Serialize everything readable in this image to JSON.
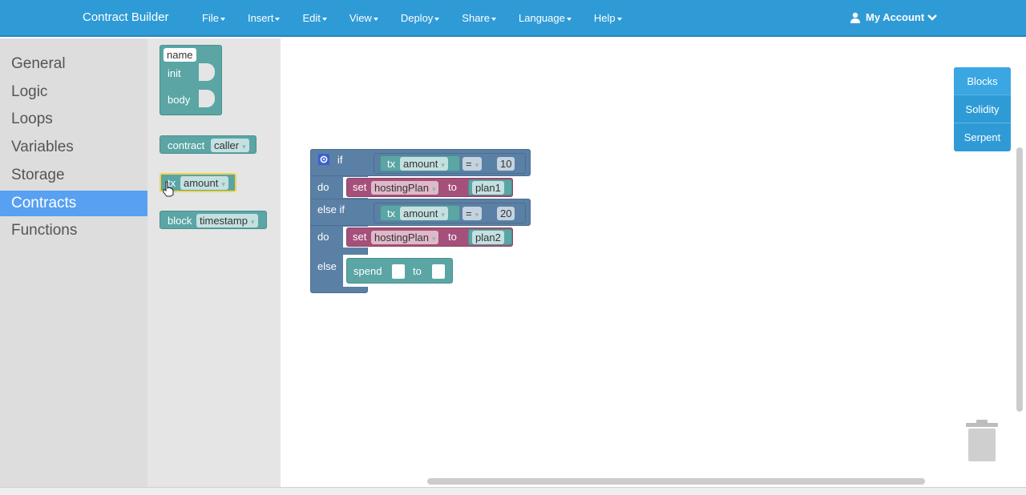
{
  "navbar": {
    "brand": "Contract Builder",
    "menu": [
      "File",
      "Insert",
      "Edit",
      "View",
      "Deploy",
      "Share",
      "Language",
      "Help"
    ],
    "account": "My Account"
  },
  "categories": [
    "General",
    "Logic",
    "Loops",
    "Variables",
    "Storage",
    "Contracts",
    "Functions"
  ],
  "selected_category": "Contracts",
  "flyout": {
    "contract_block": {
      "name_field": "name",
      "init_label": "init",
      "body_label": "body"
    },
    "caller_block": {
      "label": "contract",
      "field": "caller"
    },
    "tx_block": {
      "label": "tx",
      "field": "amount"
    },
    "timestamp_block": {
      "label": "block",
      "field": "timestamp"
    }
  },
  "workspace": {
    "if_label": "if",
    "do_label": "do",
    "elseif_label": "else if",
    "do2_label": "do",
    "else_label": "else",
    "cond1": {
      "tx": "tx",
      "field": "amount",
      "op": "=",
      "value": "10"
    },
    "set1": {
      "set": "set",
      "var": "hostingPlan",
      "to": "to",
      "value": "plan1"
    },
    "cond2": {
      "tx": "tx",
      "field": "amount",
      "op": "=",
      "value": "20"
    },
    "set2": {
      "set": "set",
      "var": "hostingPlan",
      "to": "to",
      "value": "plan2"
    },
    "spend": {
      "label": "spend",
      "to": "to"
    }
  },
  "lang_tabs": [
    "Blocks",
    "Solidity",
    "Serpent"
  ],
  "colors": {
    "navbar": "#2f9bd6",
    "selected_category": "#57a0f2",
    "control_block": "#5b80a5",
    "value_block": "#5ba5a5",
    "variable_block": "#a5507a"
  }
}
